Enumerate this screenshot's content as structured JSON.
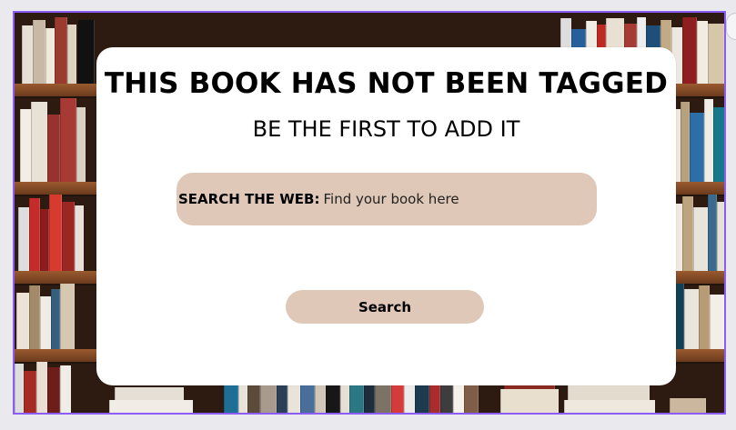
{
  "card": {
    "title": "THIS BOOK HAS NOT BEEN TAGGED",
    "subtitle": "BE THE FIRST TO ADD IT"
  },
  "search": {
    "label": "SEARCH THE WEB:",
    "placeholder": "Find your book here",
    "button_label": "Search"
  },
  "colors": {
    "card_background": "#ffffff",
    "accent_beige": "#dfc8b8",
    "selection_border": "#8b5cf6"
  }
}
